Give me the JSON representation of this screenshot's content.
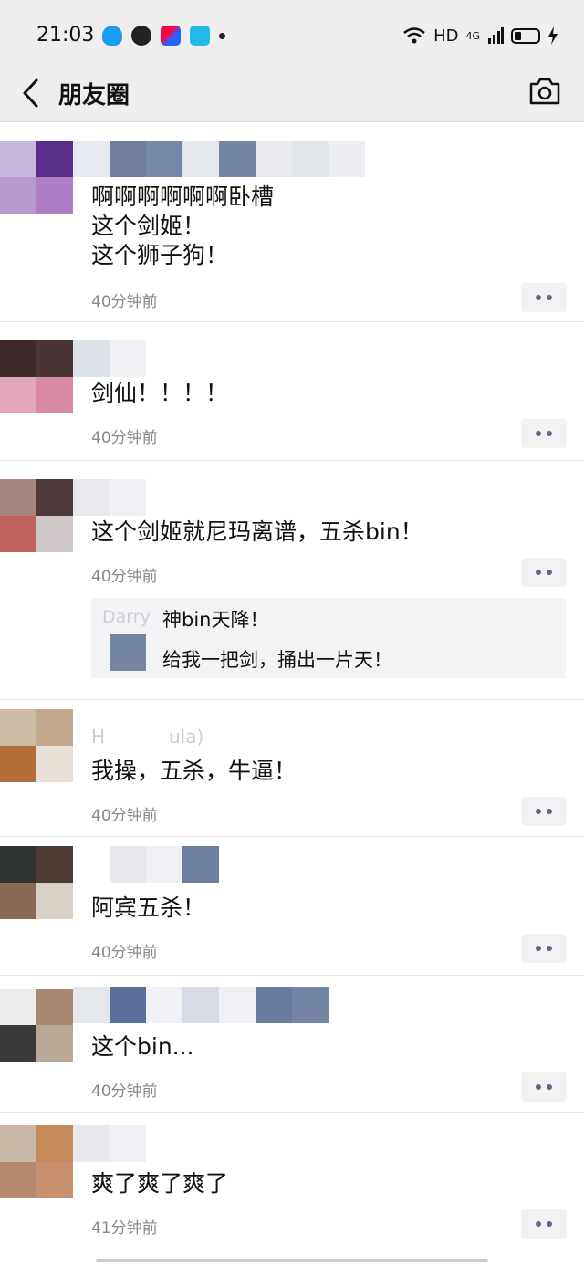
{
  "status_bar": {
    "time": "21:03",
    "network": "HD",
    "signal": "4G"
  },
  "nav": {
    "title": "朋友圈",
    "back_icon": "chevron-left-icon",
    "camera_icon": "camera-icon"
  },
  "comments": [
    {
      "text": "啊啊啊啊啊啊卧槽\n这个剑姬！\n这个狮子狗！",
      "time": "40分钟前"
    },
    {
      "text": "剑仙！！！！",
      "time": "40分钟前"
    },
    {
      "text": "这个剑姬就尼玛离谱，五杀bin！",
      "time": "40分钟前",
      "replies": [
        {
          "author": "Darry",
          "text": "神bin天降！"
        },
        {
          "author": "",
          "text": "给我一把剑，捅出一片天！"
        }
      ]
    },
    {
      "author_partial": "H           ula)",
      "text": "我操，五杀，牛逼！",
      "time": "40分钟前"
    },
    {
      "text": "阿宾五杀！",
      "time": "40分钟前"
    },
    {
      "text": "这个bin...",
      "time": "40分钟前"
    },
    {
      "text": "爽了爽了爽了",
      "time": "41分钟前"
    }
  ],
  "colors": {
    "background": "#ffffff",
    "nav_bg": "#eeeeee",
    "timestamp": "#888888",
    "more_dots": "#5a6b8a"
  }
}
